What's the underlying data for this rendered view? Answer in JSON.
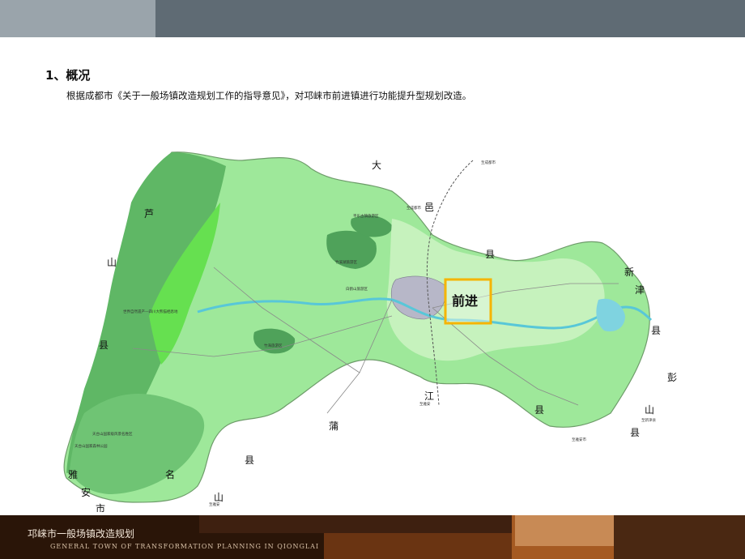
{
  "header": {
    "accent_dark": "#5f6b74",
    "accent_light": "#9aa4ab"
  },
  "section": {
    "heading": "1、概况",
    "paragraph": "根据成都市《关于一般场镇改造规划工作的指导意见》，对邛崃市前进镇进行功能提升型规划改造。"
  },
  "map": {
    "highlight_label": "前进",
    "neighbors": {
      "top": [
        "大",
        "邑",
        "县"
      ],
      "left": [
        "芦",
        "山",
        "县"
      ],
      "right": [
        "新",
        "津",
        "县",
        "彭",
        "山",
        "县"
      ],
      "bottom": [
        "江",
        "县",
        "蒲",
        "县",
        "名",
        "山",
        "雅",
        "安",
        "市"
      ]
    },
    "scenic_labels": [
      "世界自然遗产—四川大熊猫栖息地",
      "天台山国家级风景名胜区",
      "天台山国家森林公园",
      "竹溪湖旅游区",
      "平乐古镇旅游区",
      "白鹤山旅游区",
      "竹海旅游区"
    ],
    "road_labels": [
      "至成都市",
      "至成都市",
      "至雅安",
      "至雅安",
      "至雅安市",
      "至新津县"
    ],
    "colors": {
      "main": "#9ee89a",
      "dark": "#5fb765",
      "forest": "#3f9a50",
      "highlight": "#f5b400"
    }
  },
  "footer": {
    "title": "邛崃市一般场镇改造规划",
    "subtitle": "GENERAL TOWN OF TRANSFORMATION PLANNING IN QIONGLAI"
  }
}
